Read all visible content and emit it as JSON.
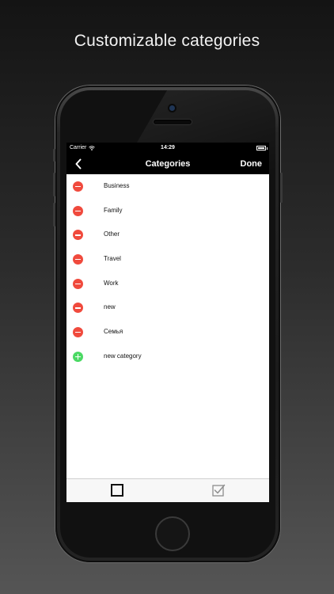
{
  "promo": {
    "headline": "Customizable categories"
  },
  "status_bar": {
    "carrier": "Carrier",
    "time": "14:29"
  },
  "nav": {
    "title": "Categories",
    "done_label": "Done",
    "back_icon": "chevron-left-icon"
  },
  "categories": [
    {
      "label": "Business",
      "action": "delete"
    },
    {
      "label": "Family",
      "action": "delete"
    },
    {
      "label": "Other",
      "action": "delete"
    },
    {
      "label": "Travel",
      "action": "delete"
    },
    {
      "label": "Work",
      "action": "delete"
    },
    {
      "label": "new",
      "action": "delete"
    },
    {
      "label": "Семья",
      "action": "delete"
    }
  ],
  "add_row": {
    "label": "new category",
    "action": "add"
  },
  "tabs": [
    {
      "icon": "empty-checkbox-icon",
      "selected": true
    },
    {
      "icon": "checked-checkbox-icon",
      "selected": false
    }
  ],
  "colors": {
    "delete": "#f04a3d",
    "add": "#4bd964",
    "nav_background": "#000000",
    "tab_selected": "#111111",
    "tab_unselected": "#8e8e8e"
  }
}
